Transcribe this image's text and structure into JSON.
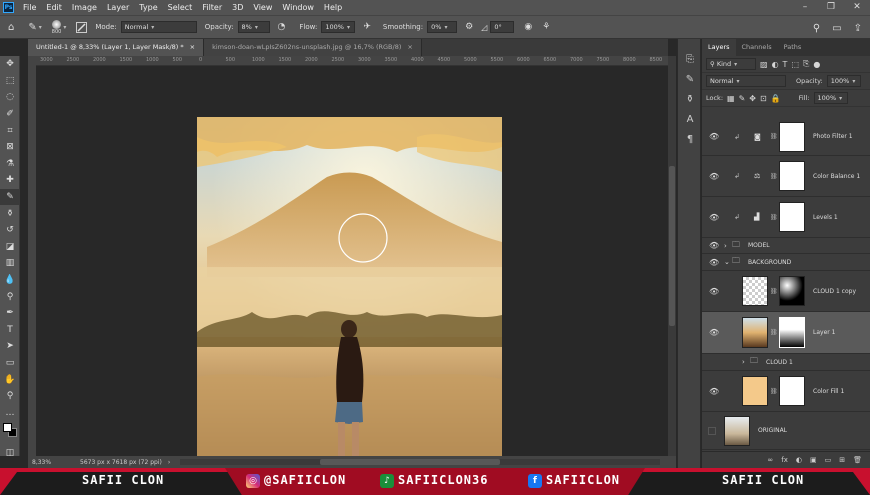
{
  "app": {
    "logo": "Ps"
  },
  "menu": [
    "File",
    "Edit",
    "Image",
    "Layer",
    "Type",
    "Select",
    "Filter",
    "3D",
    "View",
    "Window",
    "Help"
  ],
  "window_controls": [
    "–",
    "❐",
    "✕"
  ],
  "options": {
    "brush_size": "800",
    "mode_label": "Mode:",
    "mode_value": "Normal",
    "opacity_label": "Opacity:",
    "opacity_value": "8%",
    "flow_label": "Flow:",
    "flow_value": "100%",
    "smoothing_label": "Smoothing:",
    "smoothing_value": "0%",
    "angle_value": "0°"
  },
  "tabs": [
    {
      "label": "Untitled-1 @ 8,33% (Layer 1, Layer Mask/8) *",
      "close": "×"
    },
    {
      "label": "kimson-doan-wLpIsZ602ns-unsplash.jpg @ 16,7% (RGB/8)",
      "close": "×"
    }
  ],
  "ruler_ticks": [
    "3000",
    "2500",
    "2000",
    "1500",
    "1000",
    "500",
    "0",
    "500",
    "1000",
    "1500",
    "2000",
    "2500",
    "3000",
    "3500",
    "4000",
    "4500",
    "5000",
    "5500",
    "6000",
    "6500",
    "7000",
    "7500",
    "8000",
    "8500"
  ],
  "status": {
    "zoom": "8,33%",
    "doc_size": "5673 px x 7618 px (72 ppi)"
  },
  "panel": {
    "tabs": [
      "Layers",
      "Channels",
      "Paths"
    ],
    "filter_kind": "Kind",
    "blend_mode": "Normal",
    "opacity_label": "Opacity:",
    "opacity_value": "100%",
    "lock_label": "Lock:",
    "fill_label": "Fill:",
    "fill_value": "100%",
    "layers": [
      {
        "name": "Photo Filter 1"
      },
      {
        "name": "Color Balance 1"
      },
      {
        "name": "Levels 1"
      },
      {
        "name": "MODEL"
      },
      {
        "name": "BACKGROUND"
      },
      {
        "name": "CLOUD 1 copy"
      },
      {
        "name": "Layer 1"
      },
      {
        "name": "CLOUD 1"
      },
      {
        "name": "Color Fill 1"
      },
      {
        "name": "ORIGINAL"
      }
    ],
    "bottom_icons": [
      "∞",
      "fx",
      "◐",
      "▣",
      "▭",
      "⊞",
      "🗑"
    ]
  },
  "banner": {
    "left": "SAFII CLON",
    "instagram": "@SAFIICLON",
    "tiktok": "SAFIICLON36",
    "facebook": "SAFIICLON",
    "right": "SAFII CLON",
    "colors": {
      "red": "#c8102e",
      "instagram": "#d6249f",
      "tiktok": "#1a8f3a",
      "facebook": "#1877f2"
    }
  }
}
